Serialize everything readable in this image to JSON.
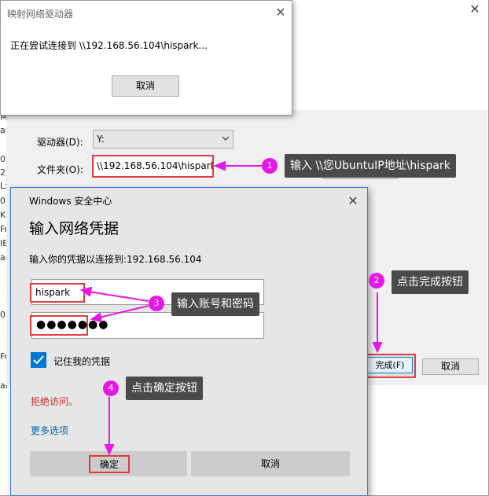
{
  "wizard": {
    "drive_label": "驱动器(D):",
    "drive_value": "Y:",
    "folder_label": "文件夹(O):",
    "folder_value": "\\\\192.168.56.104\\hispark",
    "finish_label": "完成(F)",
    "cancel_label": "取消",
    "close_glyph": "✕",
    "left_glyphs": [
      "M",
      "ar",
      "0",
      "2",
      "Lx",
      "0",
      "K",
      "Fr",
      "IE",
      "ar",
      "0",
      "Fr",
      "ar"
    ]
  },
  "connect_dialog": {
    "title": "映射网络驱动器",
    "message": "正在尝试连接到 \\\\192.168.56.104\\hispark...",
    "cancel_label": "取消",
    "close_glyph": "✕"
  },
  "cred_dialog": {
    "app_name": "Windows 安全中心",
    "heading": "输入网络凭据",
    "subtitle": "输入你的凭据以连接到:192.168.56.104",
    "username": "hispark",
    "password_mask": "●●●●●●●",
    "remember_label": "记住我的凭据",
    "remember_checked": true,
    "error_text": "拒绝访问。",
    "more_options": "更多选项",
    "ok_label": "确定",
    "cancel_label": "取消",
    "close_glyph": "✕"
  },
  "annotations": {
    "accent_color": "#e617e6",
    "callout_bg": "#4a4a4a",
    "highlight_color": "#e03c3c",
    "steps": [
      {
        "num": "1",
        "text": "输入 \\\\您UbuntuIP地址\\hispark"
      },
      {
        "num": "2",
        "text": "点击完成按钮"
      },
      {
        "num": "3",
        "text": "输入账号和密码"
      },
      {
        "num": "4",
        "text": "点击确定按钮"
      }
    ]
  }
}
